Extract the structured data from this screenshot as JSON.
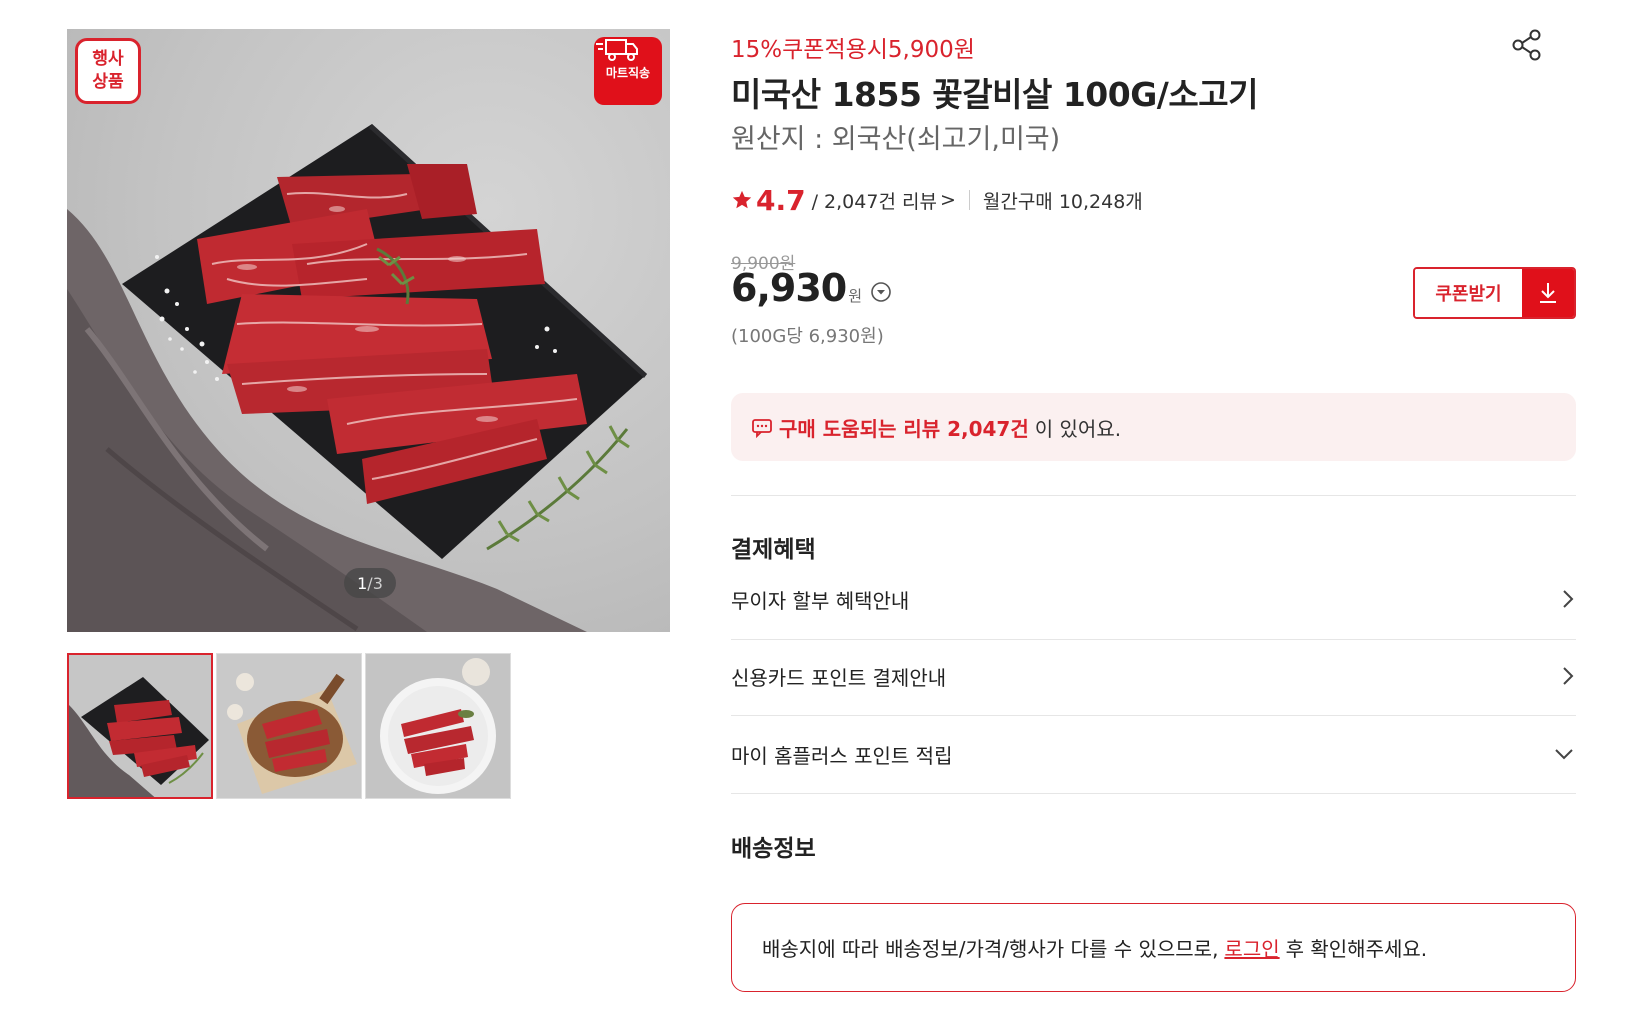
{
  "gallery": {
    "badge_event_line1": "행사",
    "badge_event_line2": "상품",
    "badge_mart": "마트직송",
    "counter_current": "1",
    "counter_total": "/3",
    "thumbnail_count": 3,
    "active_thumbnail": 1
  },
  "product": {
    "coupon_price_text": "15%쿠폰적용시5,900원",
    "title": "미국산 1855 꽃갈비살 100G/소고기",
    "origin": "원산지 : 외국산(쇠고기,미국)",
    "rating": "4.7",
    "review_count_text": "/ 2,047건 리뷰",
    "review_chevron": ">",
    "monthly_sales": "월간구매 10,248개",
    "original_price": "9,900원",
    "price": "6,930",
    "price_unit": "원",
    "unit_price": "(100G당 6,930원)",
    "coupon_button_label": "쿠폰받기"
  },
  "review_banner": {
    "highlight": "구매 도움되는 리뷰 2,047건",
    "rest": "이 있어요."
  },
  "payment_benefits": {
    "title": "결제혜택",
    "items": [
      {
        "label": "무이자 할부 혜택안내",
        "icon": "chevron-right-icon"
      },
      {
        "label": "신용카드 포인트 결제안내",
        "icon": "chevron-right-icon"
      },
      {
        "label": "마이 홈플러스 포인트 적립",
        "icon": "chevron-down-icon"
      }
    ]
  },
  "shipping": {
    "title": "배송정보",
    "notice_before": "배송지에 따라 배송정보/가격/행사가 다를 수 있으므로,",
    "login_link": "로그인",
    "notice_after": "후 확인해주세요."
  },
  "colors": {
    "accent": "#d9232d",
    "banner_bg": "#fbf0f0",
    "text": "#222222",
    "muted": "#777777"
  }
}
